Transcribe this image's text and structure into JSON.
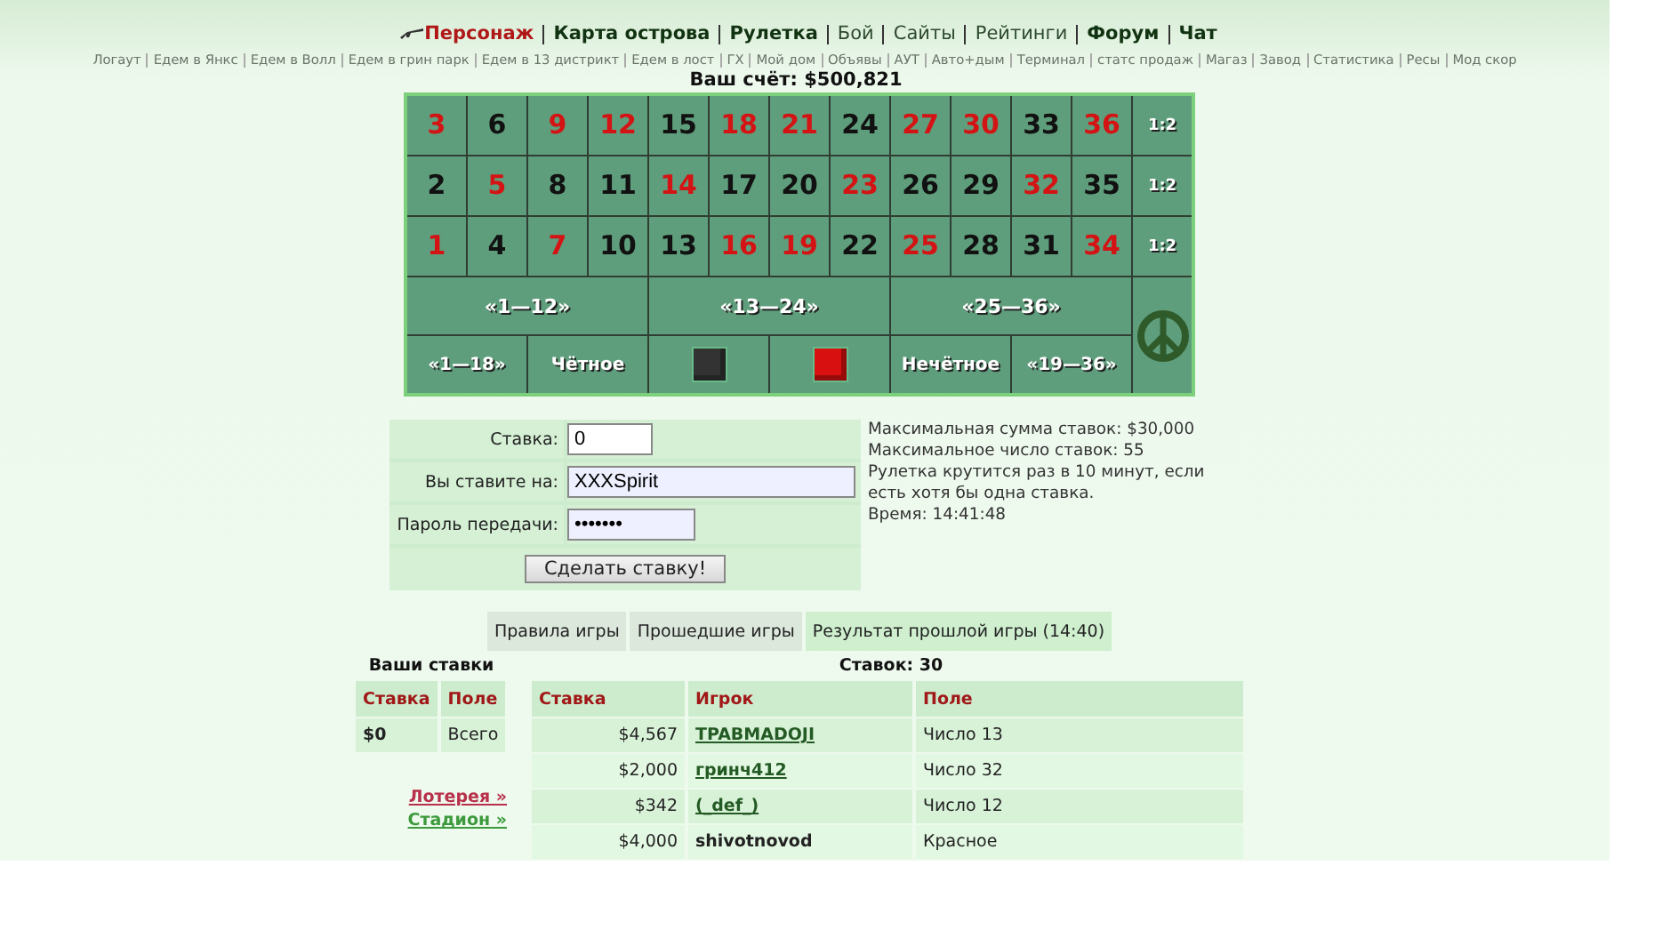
{
  "nav": [
    {
      "label": "Персонаж",
      "kind": "character"
    },
    {
      "label": "Карта острова",
      "kind": "main"
    },
    {
      "label": "Рулетка",
      "kind": "main"
    },
    {
      "label": "Бой",
      "kind": "plain"
    },
    {
      "label": "Сайты",
      "kind": "plain"
    },
    {
      "label": "Рейтинги",
      "kind": "plain"
    },
    {
      "label": "Форум",
      "kind": "main"
    },
    {
      "label": "Чат",
      "kind": "main"
    }
  ],
  "sublinks": [
    "Логаут",
    "Едем в Янкс",
    "Едем в Волл",
    "Едем в грин парк",
    "Едем в 13 дистрикт",
    "Едем в лост",
    "ГХ",
    "Мой дом",
    "Объявы",
    "АУТ",
    "Авто+дым",
    "Терминал",
    "статс продаж",
    "Магаз",
    "Завод",
    "Статистика",
    "Ресы",
    "Мод скор"
  ],
  "score": "Ваш счёт: $500,821",
  "board": {
    "rows": [
      {
        "numbers": [
          {
            "label": "3",
            "color": "#d41414"
          },
          {
            "label": "6",
            "color": "#111111"
          },
          {
            "label": "9",
            "color": "#d41414"
          },
          {
            "label": "12",
            "color": "#d41414"
          },
          {
            "label": "15",
            "color": "#111111"
          },
          {
            "label": "18",
            "color": "#d41414"
          },
          {
            "label": "21",
            "color": "#d41414"
          },
          {
            "label": "24",
            "color": "#111111"
          },
          {
            "label": "27",
            "color": "#d41414"
          },
          {
            "label": "30",
            "color": "#d41414"
          },
          {
            "label": "33",
            "color": "#111111"
          },
          {
            "label": "36",
            "color": "#d41414"
          }
        ],
        "payout": "1:2"
      },
      {
        "numbers": [
          {
            "label": "2",
            "color": "#111111"
          },
          {
            "label": "5",
            "color": "#d41414"
          },
          {
            "label": "8",
            "color": "#111111"
          },
          {
            "label": "11",
            "color": "#111111"
          },
          {
            "label": "14",
            "color": "#d41414"
          },
          {
            "label": "17",
            "color": "#111111"
          },
          {
            "label": "20",
            "color": "#111111"
          },
          {
            "label": "23",
            "color": "#d41414"
          },
          {
            "label": "26",
            "color": "#111111"
          },
          {
            "label": "29",
            "color": "#111111"
          },
          {
            "label": "32",
            "color": "#d41414"
          },
          {
            "label": "35",
            "color": "#111111"
          }
        ],
        "payout": "1:2"
      },
      {
        "numbers": [
          {
            "label": "1",
            "color": "#d41414"
          },
          {
            "label": "4",
            "color": "#111111"
          },
          {
            "label": "7",
            "color": "#d41414"
          },
          {
            "label": "10",
            "color": "#111111"
          },
          {
            "label": "13",
            "color": "#111111"
          },
          {
            "label": "16",
            "color": "#d41414"
          },
          {
            "label": "19",
            "color": "#d41414"
          },
          {
            "label": "22",
            "color": "#111111"
          },
          {
            "label": "25",
            "color": "#d41414"
          },
          {
            "label": "28",
            "color": "#111111"
          },
          {
            "label": "31",
            "color": "#111111"
          },
          {
            "label": "34",
            "color": "#d41414"
          }
        ],
        "payout": "1:2"
      }
    ],
    "dozens": [
      "«1—12»",
      "«13—24»",
      "«25—36»"
    ],
    "outside": [
      {
        "kind": "text",
        "label": "«1—18»"
      },
      {
        "kind": "text",
        "label": "Чётное"
      },
      {
        "kind": "swatch",
        "color": "#333333"
      },
      {
        "kind": "swatch",
        "color": "#d81010"
      },
      {
        "kind": "text",
        "label": "Нечётное"
      },
      {
        "kind": "text",
        "label": "«19—36»"
      }
    ]
  },
  "form": {
    "fields": [
      {
        "label": "Ставка:",
        "value": "0"
      },
      {
        "label": "Вы ставите на:",
        "value": "XXXSpirit"
      },
      {
        "label": "Пароль передачи:",
        "value": "•••••••"
      }
    ],
    "submit": "Сделать ставку!"
  },
  "info": [
    "Максимальная сумма ставок: $30,000",
    "Максимальное число ставок: 55",
    "Рулетка крутится раз в 10 минут, если есть хотя бы одна ставка.",
    "Время: 14:41:48"
  ],
  "tabs": [
    {
      "label": "Правила игры",
      "selected": false
    },
    {
      "label": "Прошедшие игры",
      "selected": false
    },
    {
      "label": "Результат прошлой игры (14:40)",
      "selected": true
    }
  ],
  "my_bets": {
    "title": "Ваши ставки",
    "columns": [
      "Ставка",
      "Поле"
    ],
    "rows": [
      [
        "$0",
        "Всего"
      ]
    ]
  },
  "side_links": [
    {
      "label": "Лотерея »",
      "color": "#b8304a"
    },
    {
      "label": "Стадион »",
      "color": "#3c9a3c"
    }
  ],
  "bets": {
    "title": "Ставок: 30",
    "columns": [
      "Ставка",
      "Игрок",
      "Поле"
    ],
    "rows": [
      {
        "amount": "$4,567",
        "player": "TPABMADOJI",
        "linked": true,
        "field": "Число 13"
      },
      {
        "amount": "$2,000",
        "player": "гринч412",
        "linked": true,
        "field": "Число 32"
      },
      {
        "amount": "$342",
        "player": "(_def_)",
        "linked": true,
        "field": "Число 12"
      },
      {
        "amount": "$4,000",
        "player": "shivotnovod",
        "linked": false,
        "field": "Красное"
      }
    ]
  }
}
